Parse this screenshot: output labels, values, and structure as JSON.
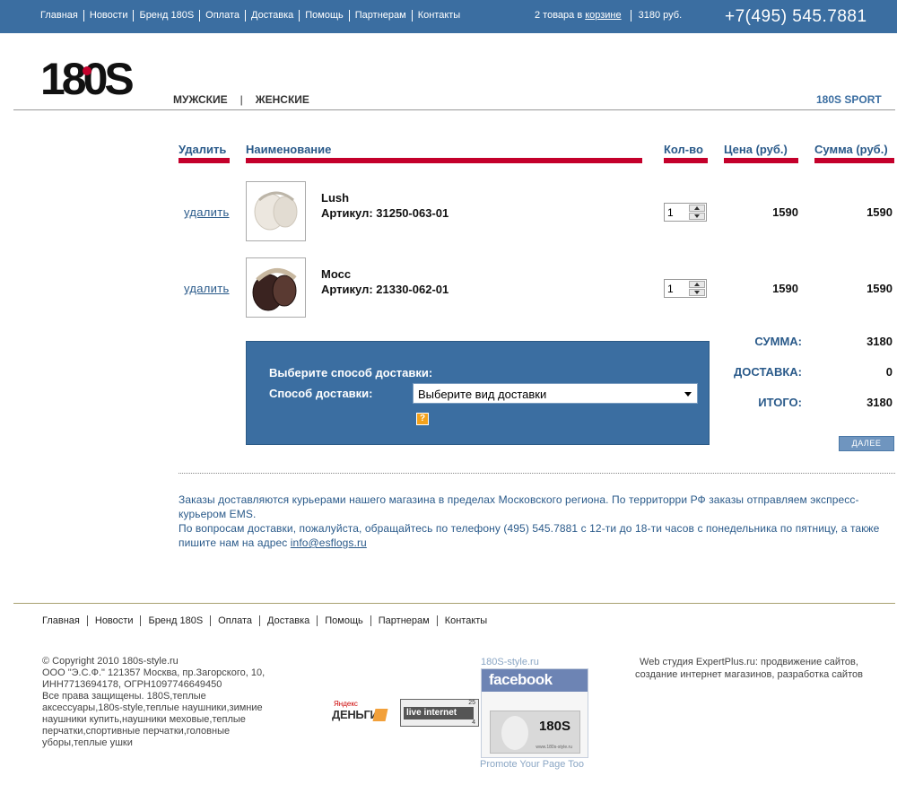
{
  "topnav": [
    "Главная",
    "Новости",
    "Бренд 180S",
    "Оплата",
    "Доставка",
    "Помощь",
    "Партнерам",
    "Контакты"
  ],
  "cart": {
    "prefix": "2 товара в",
    "link": "корзине",
    "sum": "3180 руб."
  },
  "phone": "+7(495) 545.7881",
  "logo_text": "180S",
  "catnav": {
    "men": "МУЖСКИЕ",
    "sep": "|",
    "women": "ЖЕНСКИЕ",
    "sport": "180S SPORT"
  },
  "table": {
    "headers": {
      "delete": "Удалить",
      "name": "Наименование",
      "qty": "Кол-во",
      "price": "Цена (руб.)",
      "sum": "Сумма (руб.)"
    },
    "rows": [
      {
        "delete": "удалить",
        "name": "Lush",
        "article": "Артикул: 31250-063-01",
        "qty": "1",
        "price": "1590",
        "sum": "1590"
      },
      {
        "delete": "удалить",
        "name": "Мосс",
        "article": "Артикул: 21330-062-01",
        "qty": "1",
        "price": "1590",
        "sum": "1590"
      }
    ]
  },
  "delivery": {
    "title": "Выберите способ доставки:",
    "label": "Способ доставки:",
    "select": "Выберите вид доставки",
    "help": "?"
  },
  "totals": {
    "sum_label": "СУММА:",
    "sum_value": "3180",
    "delivery_label": "ДОСТАВКА:",
    "delivery_value": "0",
    "total_label": "ИТОГО:",
    "total_value": "3180"
  },
  "next_button": "ДАЛЕЕ",
  "info": {
    "line1": "Заказы доставляются курьерами нашего магазина в пределах Московского региона. По территорри РФ заказы отправляем экспресс-курьером EMS.",
    "line2": "По вопросам доставки, пожалуйста, обращайтесь по телефону (495) 545.7881 с 12-ти до 18-ти часов с понедельника по пятницу, а также пишите нам на адрес",
    "email": "info@esflogs.ru"
  },
  "footnav": [
    "Главная",
    "Новости",
    "Бренд 180S",
    "Оплата",
    "Доставка",
    "Помощь",
    "Партнерам",
    "Контакты"
  ],
  "copyright": {
    "l1": "© Copyright 2010 180s-style.ru",
    "l2": "ООО \"Э.С.Ф.\" 121357 Москва, пр.Загорского, 10,",
    "l3": "ИНН7713694178, ОГРН1097746649450",
    "l4": "Все права защищены.  180S,теплые аксессуары,180s-style,теплые наушники,зимние наушники купить,наушники меховые,теплые перчатки,спортивные перчатки,головные уборы,теплые ушки"
  },
  "yandex": {
    "top": "Яндекс",
    "main": "ДЕНЬГИ"
  },
  "liveinternet": {
    "label": "live internet",
    "n1": "25",
    "n2": "4"
  },
  "facebook": {
    "caption": "180S-style.ru",
    "brand": "facebook",
    "logo": "180S",
    "site": "www.180s-style.ru",
    "promo": "Promote Your Page Too"
  },
  "studio": {
    "l1": "Web студия ExpertPlus.ru: продвижение сайтов,",
    "l2": "создание интернет магазинов, разработка сайтов"
  },
  "colors": {
    "topbar": "#3b6ea1",
    "accent_red": "#c4002b",
    "header_blue": "#2a5a8a"
  }
}
